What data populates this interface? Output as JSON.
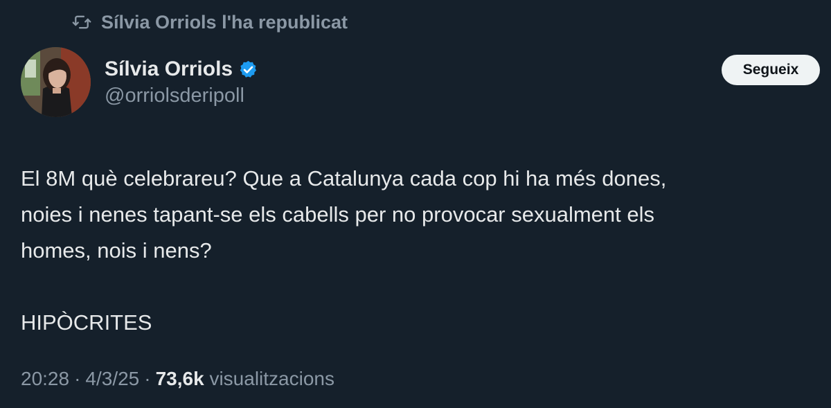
{
  "repost": {
    "icon": "repost-icon",
    "text": "Sílvia Orriols l'ha republicat"
  },
  "author": {
    "avatar": "avatar",
    "display_name": "Sílvia Orriols",
    "verified_icon": "verified-badge-icon",
    "handle": "@orriolsderipoll"
  },
  "follow_button": {
    "label": "Segueix"
  },
  "tweet": {
    "lines": [
      "El 8M què celebrareu?  Que a Catalunya cada cop hi ha més dones,",
      "noies i nenes tapant-se els cabells per no provocar sexualment els",
      "homes, nois i nens?"
    ],
    "closing": "HIPÒCRITES"
  },
  "meta": {
    "time": "20:28",
    "separator": "·",
    "date": "4/3/25",
    "views_count": "73,6k",
    "views_label": "visualitzacions"
  },
  "colors": {
    "background": "#15202b",
    "text_primary": "#e7e9ea",
    "text_secondary": "#8b98a5",
    "verified_blue": "#1d9bf0",
    "button_bg": "#eff3f4"
  }
}
